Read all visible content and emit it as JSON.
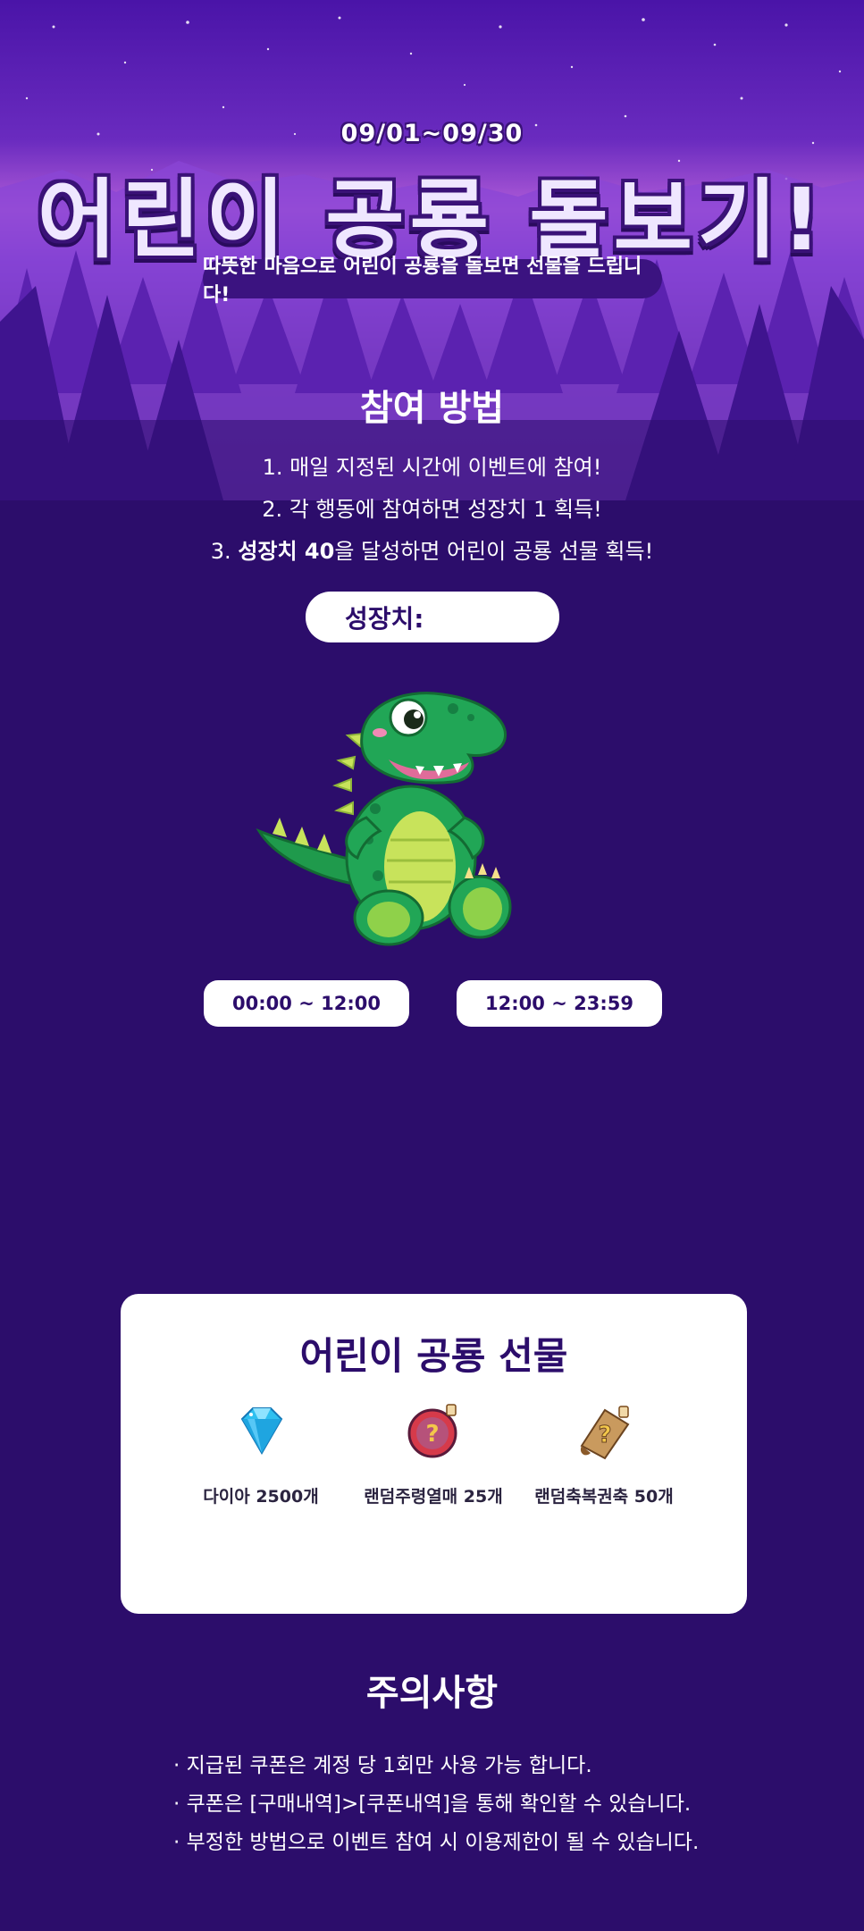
{
  "hero": {
    "date": "09/01~09/30",
    "title": "어린이 공룡 돌보기!",
    "subtitle": "따뜻한 마음으로 어린이 공룡을 돌보면 선물을 드립니다!"
  },
  "howto": {
    "title": "참여 방법",
    "line1": "1. 매일 지정된 시간에 이벤트에 참여!",
    "line2": "2. 각 행동에 참여하면 성장치 1 획득!",
    "line3_prefix": "3. ",
    "line3_bold": "성장치 40",
    "line3_suffix": "을 달성하면 어린이 공룡 선물 획득!"
  },
  "growth": {
    "label": "성장치:",
    "value": ""
  },
  "mascot": {
    "icon": "dinosaur-mascot"
  },
  "time_slots": [
    {
      "label": "00:00 ~ 12:00"
    },
    {
      "label": "12:00 ~ 23:59"
    }
  ],
  "rewards": {
    "title": "어린이 공룡 선물",
    "items": [
      {
        "label": "다이아 2500개",
        "icon": "diamond-icon"
      },
      {
        "label": "랜덤주령열매 25개",
        "icon": "mystery-fruit-icon"
      },
      {
        "label": "랜덤축복권축 50개",
        "icon": "mystery-scroll-icon"
      }
    ]
  },
  "notice": {
    "title": "주의사항",
    "items": [
      "· 지급된 쿠폰은 계정 당 1회만 사용 가능 합니다.",
      "· 쿠폰은 [구매내역]>[쿠폰내역]을 통해 확인할 수 있습니다.",
      "· 부정한 방법으로 이벤트 참여 시 이용제한이 될 수 있습니다."
    ]
  },
  "colors": {
    "background": "#2c0d6b",
    "sky_top": "#4a14a8",
    "sky_glow": "#c56ae0",
    "card": "#ffffff",
    "accent_text": "#2c0d6b"
  }
}
